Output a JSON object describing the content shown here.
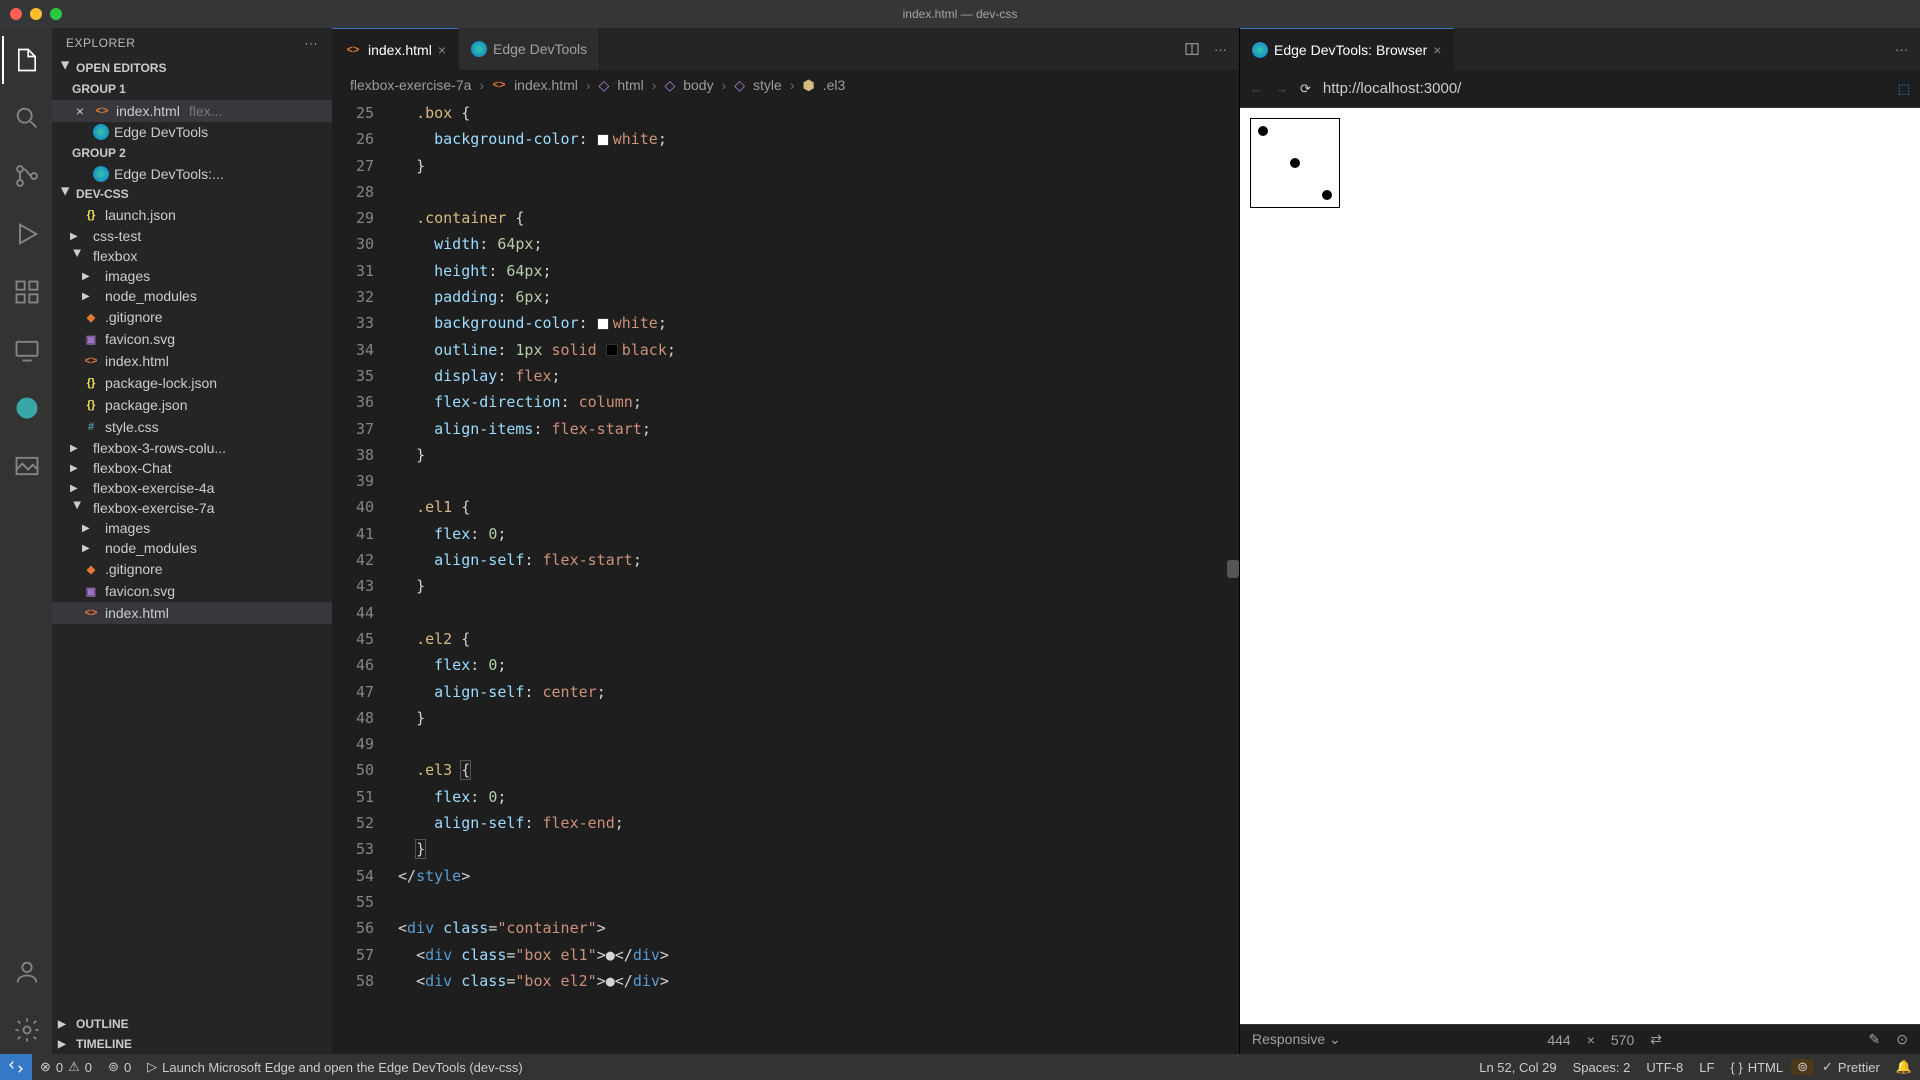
{
  "window_title": "index.html — dev-css",
  "sidebar": {
    "title": "EXPLORER",
    "open_editors": "OPEN EDITORS",
    "group1": "GROUP 1",
    "group2": "GROUP 2",
    "oe_file1": "index.html",
    "oe_file1_path": "flex...",
    "oe_file2": "Edge DevTools",
    "oe_file3": "Edge DevTools:...",
    "project": "DEV-CSS",
    "tree": {
      "launch": "launch.json",
      "csstest": "css-test",
      "flexbox": "flexbox",
      "images": "images",
      "node_modules": "node_modules",
      "gitignore": ".gitignore",
      "favicon": "favicon.svg",
      "indexhtml": "index.html",
      "pkglock": "package-lock.json",
      "pkg": "package.json",
      "stylecss": "style.css",
      "fb3": "flexbox-3-rows-colu...",
      "fbchat": "flexbox-Chat",
      "fb4a": "flexbox-exercise-4a",
      "fb7a": "flexbox-exercise-7a",
      "images2": "images",
      "node_modules2": "node_modules",
      "gitignore2": ".gitignore",
      "favicon2": "favicon.svg",
      "indexhtml2": "index.html"
    },
    "outline": "OUTLINE",
    "timeline": "TIMELINE"
  },
  "tabs": {
    "index": "index.html",
    "devtools": "Edge DevTools",
    "browser": "Edge DevTools: Browser"
  },
  "breadcrumb": {
    "b1": "flexbox-exercise-7a",
    "b2": "index.html",
    "b3": "html",
    "b4": "body",
    "b5": "style",
    "b6": ".el3"
  },
  "code": {
    "lines": [
      "25",
      "26",
      "27",
      "28",
      "29",
      "30",
      "31",
      "32",
      "33",
      "34",
      "35",
      "36",
      "37",
      "38",
      "39",
      "40",
      "41",
      "42",
      "43",
      "44",
      "45",
      "46",
      "47",
      "48",
      "49",
      "50",
      "51",
      "52",
      "53",
      "54",
      "55",
      "56",
      "57",
      "58"
    ]
  },
  "browser": {
    "url": "http://localhost:3000/",
    "responsive": "Responsive",
    "width": "444",
    "height": "570"
  },
  "status": {
    "err": "0",
    "warn": "0",
    "port": "0",
    "launch": "Launch Microsoft Edge and open the Edge DevTools (dev-css)",
    "pos": "Ln 52, Col 29",
    "spaces": "Spaces: 2",
    "enc": "UTF-8",
    "eol": "LF",
    "lang": "HTML",
    "prettier": "Prettier"
  }
}
